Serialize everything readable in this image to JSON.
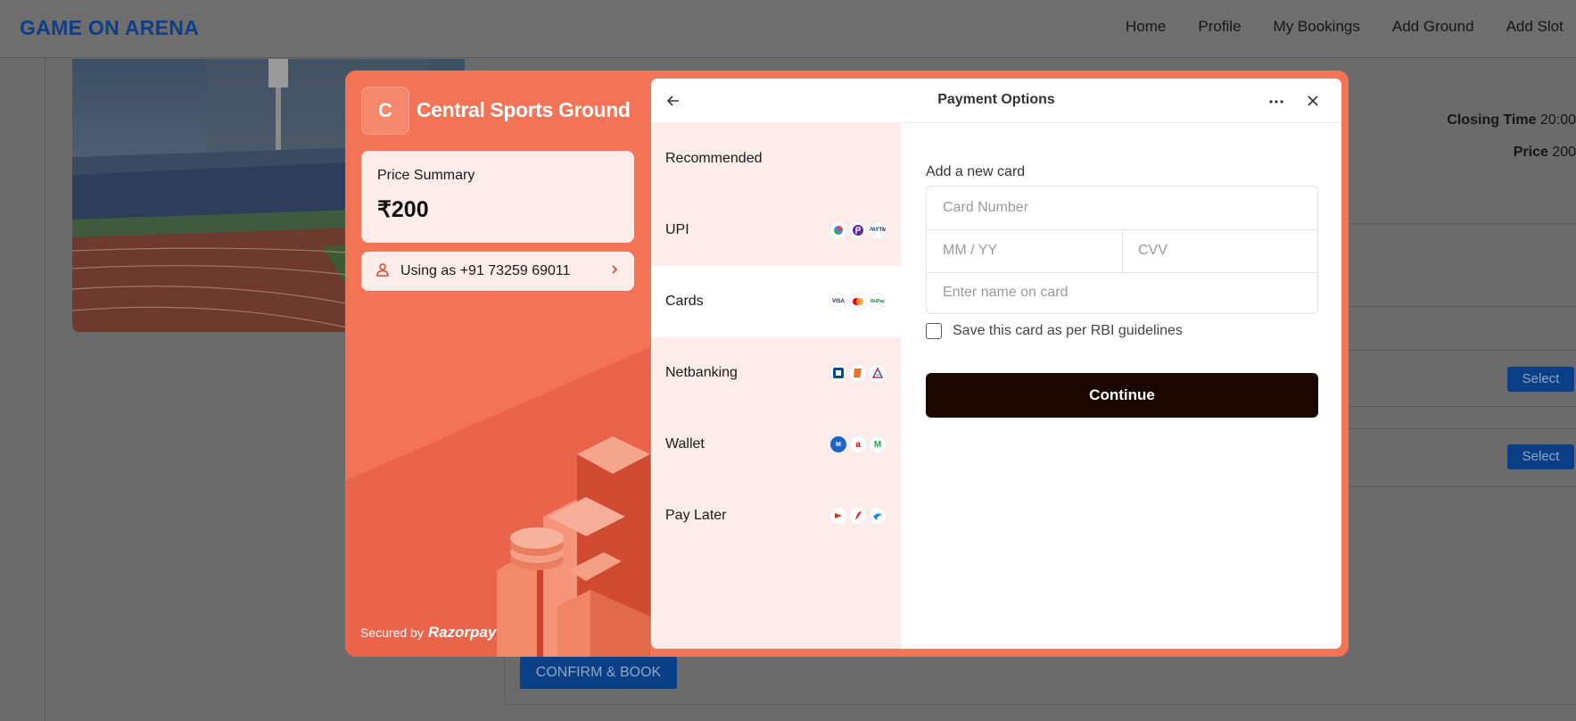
{
  "navbar": {
    "brand": "GAME ON ARENA",
    "links": [
      "Home",
      "Profile",
      "My Bookings",
      "Add Ground",
      "Add Slot"
    ]
  },
  "background": {
    "closing_label": "Closing Time",
    "closing_value": "20:00",
    "price_label": "Price",
    "price_value": "200",
    "select_label": "Select",
    "confirm_label": "CONFIRM & BOOK"
  },
  "modal": {
    "avatar_letter": "C",
    "merchant_name": "Central Sports Ground",
    "price_summary_label": "Price Summary",
    "price_amount": "₹200",
    "user_text": "Using as +91 73259 69011",
    "secured_by": "Secured by",
    "brand_name": "Razorpay"
  },
  "panel": {
    "title": "Payment Options",
    "methods": [
      {
        "label": "Recommended",
        "logos": []
      },
      {
        "label": "UPI",
        "logos": [
          "google-pay-icon",
          "phonepe-icon",
          "paytm-icon"
        ]
      },
      {
        "label": "Cards",
        "logos": [
          "visa-icon",
          "mastercard-icon",
          "rupay-icon"
        ]
      },
      {
        "label": "Netbanking",
        "logos": [
          "hdfc-icon",
          "icici-icon",
          "axis-icon"
        ]
      },
      {
        "label": "Wallet",
        "logos": [
          "mobikwik-icon",
          "airtel-icon",
          "mpesa-icon"
        ]
      },
      {
        "label": "Pay Later",
        "logos": [
          "lazypay-icon",
          "simpl-icon",
          "icici-paylater-icon"
        ]
      }
    ],
    "active_method": "Cards",
    "form": {
      "heading": "Add a new card",
      "card_number_placeholder": "Card Number",
      "expiry_placeholder": "MM / YY",
      "cvv_placeholder": "CVV",
      "name_placeholder": "Enter name on card",
      "save_label": "Save this card as per RBI guidelines",
      "save_checked": false,
      "continue_label": "Continue"
    }
  },
  "colors": {
    "accent": "#f27356",
    "pane_bg": "#fdecea",
    "continue_bg": "#1b0700",
    "brand_blue": "#0e3e88"
  }
}
